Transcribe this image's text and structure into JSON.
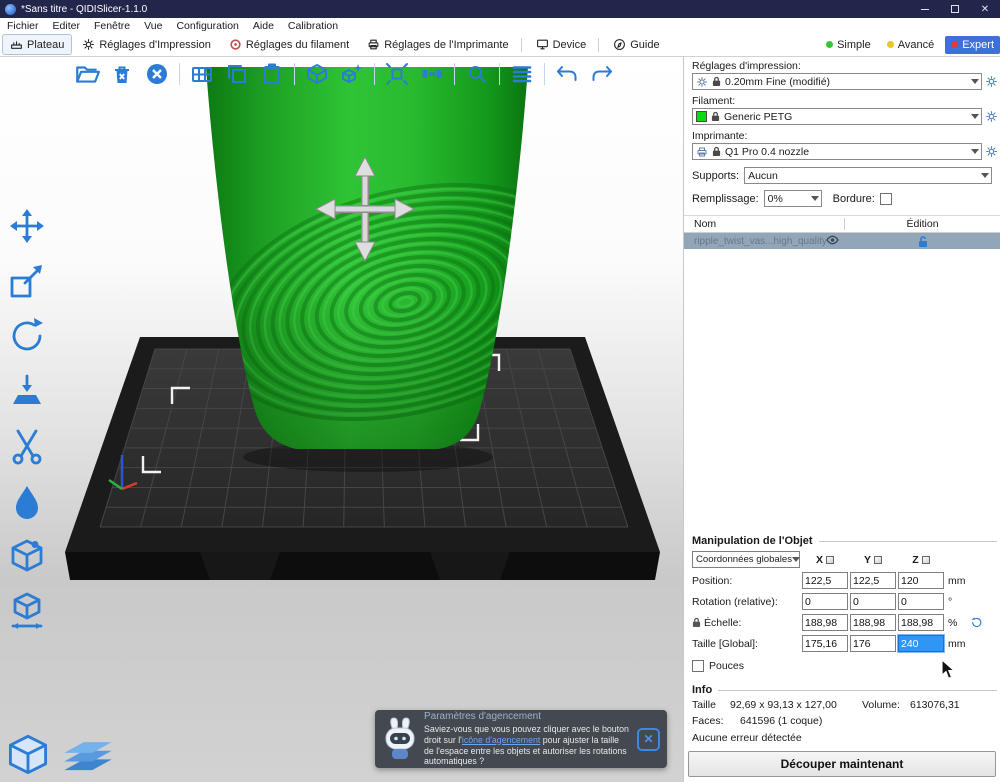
{
  "window": {
    "title": "*Sans titre - QIDISlicer-1.1.0"
  },
  "menu": {
    "items": [
      "Fichier",
      "Editer",
      "Fenêtre",
      "Vue",
      "Configuration",
      "Aide",
      "Calibration"
    ]
  },
  "tabs": {
    "items": [
      {
        "label": "Plateau"
      },
      {
        "label": "Réglages d'Impression"
      },
      {
        "label": "Réglages du filament"
      },
      {
        "label": "Réglages de l'Imprimante"
      },
      {
        "label": "Device"
      },
      {
        "label": "Guide"
      }
    ],
    "modes": [
      {
        "label": "Simple",
        "color": "#35c43a"
      },
      {
        "label": "Avancé",
        "color": "#e8c62c"
      },
      {
        "label": "Expert",
        "color": "#e03a3a"
      }
    ]
  },
  "sidebar": {
    "print": {
      "label": "Réglages d'impression:",
      "value": "0.20mm Fine (modifié)"
    },
    "filament": {
      "label": "Filament:",
      "value": "Generic PETG",
      "swatch": "#12d812"
    },
    "printer": {
      "label": "Imprimante:",
      "value": "Q1 Pro 0.4 nozzle"
    },
    "supports": {
      "label": "Supports:",
      "value": "Aucun"
    },
    "infill": {
      "label": "Remplissage:",
      "value": "0%"
    },
    "brim": {
      "label": "Bordure:",
      "checked": false
    },
    "objects": {
      "columns": [
        "Nom",
        "Édition"
      ],
      "rows": [
        {
          "name": "ripple_twist_vas...high_quality.STL"
        }
      ]
    },
    "manip": {
      "title": "Manipulation de l'Objet",
      "coords": "Coordonnées globales",
      "axes": [
        "X",
        "Y",
        "Z"
      ],
      "position": {
        "label": "Position:",
        "x": "122,5",
        "y": "122,5",
        "z": "120",
        "unit": "mm"
      },
      "rotation": {
        "label": "Rotation (relative):",
        "x": "0",
        "y": "0",
        "z": "0",
        "unit": "°"
      },
      "scale": {
        "label": "Échelle:",
        "x": "188,98",
        "y": "188,98",
        "z": "188,98",
        "unit": "%"
      },
      "size": {
        "label": "Taille [Global]:",
        "x": "175,16",
        "y": "176",
        "z": "240",
        "unit": "mm"
      },
      "inches": "Pouces"
    },
    "info": {
      "title": "Info",
      "size_label": "Taille",
      "size": "92,69 x 93,13 x 127,00",
      "volume_label": "Volume:",
      "volume": "613076,31",
      "faces_label": "Faces:",
      "faces": "641596 (1 coque)",
      "errors": "Aucune erreur détectée"
    },
    "slice": "Découper maintenant"
  },
  "notification": {
    "title": "Paramètres d'agencement",
    "body1": "Saviez-vous que vous pouvez cliquer avec le bouton droit sur l'",
    "link": "icône d'agencement",
    "body2": " pour ajuster la taille de l'espace entre les objets et autoriser les rotations automatiques ?"
  },
  "colors": {
    "accent": "#2a7cd5",
    "titlebar": "#22264b",
    "selection": "#2f96f3",
    "row_highlight": "#92a6ba",
    "model_green": "#2fc436"
  }
}
